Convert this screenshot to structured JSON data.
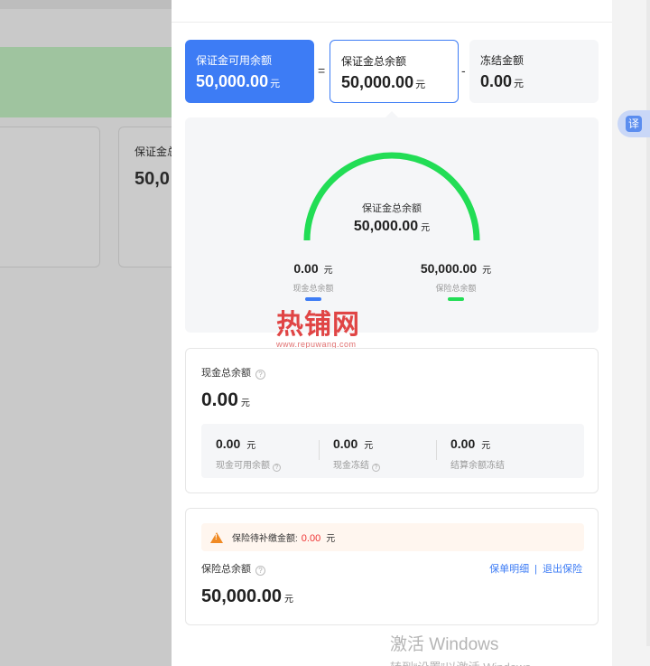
{
  "background": {
    "card_label": "保证金总",
    "card_value": "50,0"
  },
  "translate_button": {
    "label": "译"
  },
  "formula": {
    "available": {
      "label": "保证金可用余额",
      "value": "50,000.00",
      "unit": "元"
    },
    "equals": "=",
    "total": {
      "label": "保证金总余额",
      "value": "50,000.00",
      "unit": "元"
    },
    "minus": "-",
    "frozen": {
      "label": "冻结金额",
      "value": "0.00",
      "unit": "元"
    }
  },
  "gauge": {
    "title": "保证金总余额",
    "value": "50,000.00",
    "unit": "元",
    "cash_fraction": 0.0,
    "insurance_fraction": 1.0,
    "colors": {
      "cash": "#3d7cf5",
      "insurance": "#22dd55"
    },
    "legend": [
      {
        "value": "0.00",
        "unit": "元",
        "label": "现金总余额",
        "color": "#3d7cf5"
      },
      {
        "value": "50,000.00",
        "unit": "元",
        "label": "保险总余额",
        "color": "#22dd55"
      }
    ]
  },
  "watermark": {
    "text": "热铺网",
    "url": "www.repuwang.com"
  },
  "cash": {
    "title": "现金总余额",
    "value": "0.00",
    "unit": "元",
    "items": [
      {
        "value": "0.00",
        "unit": "元",
        "label": "现金可用余额"
      },
      {
        "value": "0.00",
        "unit": "元",
        "label": "现金冻结"
      },
      {
        "value": "0.00",
        "unit": "元",
        "label": "结算余额冻结"
      }
    ]
  },
  "insurance": {
    "warning_label": "保险待补缴金额:",
    "warning_amount": "0.00",
    "warning_unit": "元",
    "title": "保险总余额",
    "link_details": "保单明细",
    "link_separator": "|",
    "link_exit": "退出保险",
    "value": "50,000.00",
    "unit": "元"
  },
  "windows_activation": {
    "line1": "激活 Windows",
    "line2": "转到“设置”以激活 Windows。"
  }
}
